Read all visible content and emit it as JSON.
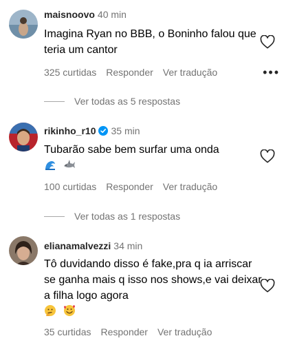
{
  "comments": [
    {
      "username": "maisnoovo",
      "time": "40 min",
      "text": "Imagina Ryan no BBB, o Boninho falou que teria um cantor",
      "likes": "325 curtidas",
      "reply": "Responder",
      "translate": "Ver tradução",
      "more": "•••",
      "replies": "Ver todas as 5 respostas"
    },
    {
      "username": "rikinho_r10",
      "time": "35 min",
      "verified": true,
      "text": "Tubarão sabe bem surfar uma onda",
      "emojis": [
        "wave",
        "shark"
      ],
      "likes": "100 curtidas",
      "reply": "Responder",
      "translate": "Ver tradução",
      "replies": "Ver todas as 1 respostas"
    },
    {
      "username": "elianamalvezzi",
      "time": "34 min",
      "text": "Tô duvidando disso é fake,pra q ia arriscar se ganha mais q isso nos shows,e vai deixar a filha logo agora",
      "emojis": [
        "thinking-face",
        "face-with-hearts"
      ],
      "likes": "35 curtidas",
      "reply": "Responder",
      "translate": "Ver tradução"
    }
  ],
  "colors": {
    "primary_text": "#000000",
    "username": "#262626",
    "secondary_text": "#737373",
    "verified_blue": "#0095f6",
    "divider": "#a8a8a8"
  },
  "icons": {
    "like": "heart-outline-icon",
    "verified": "verified-badge-icon",
    "more": "more-options-icon"
  }
}
